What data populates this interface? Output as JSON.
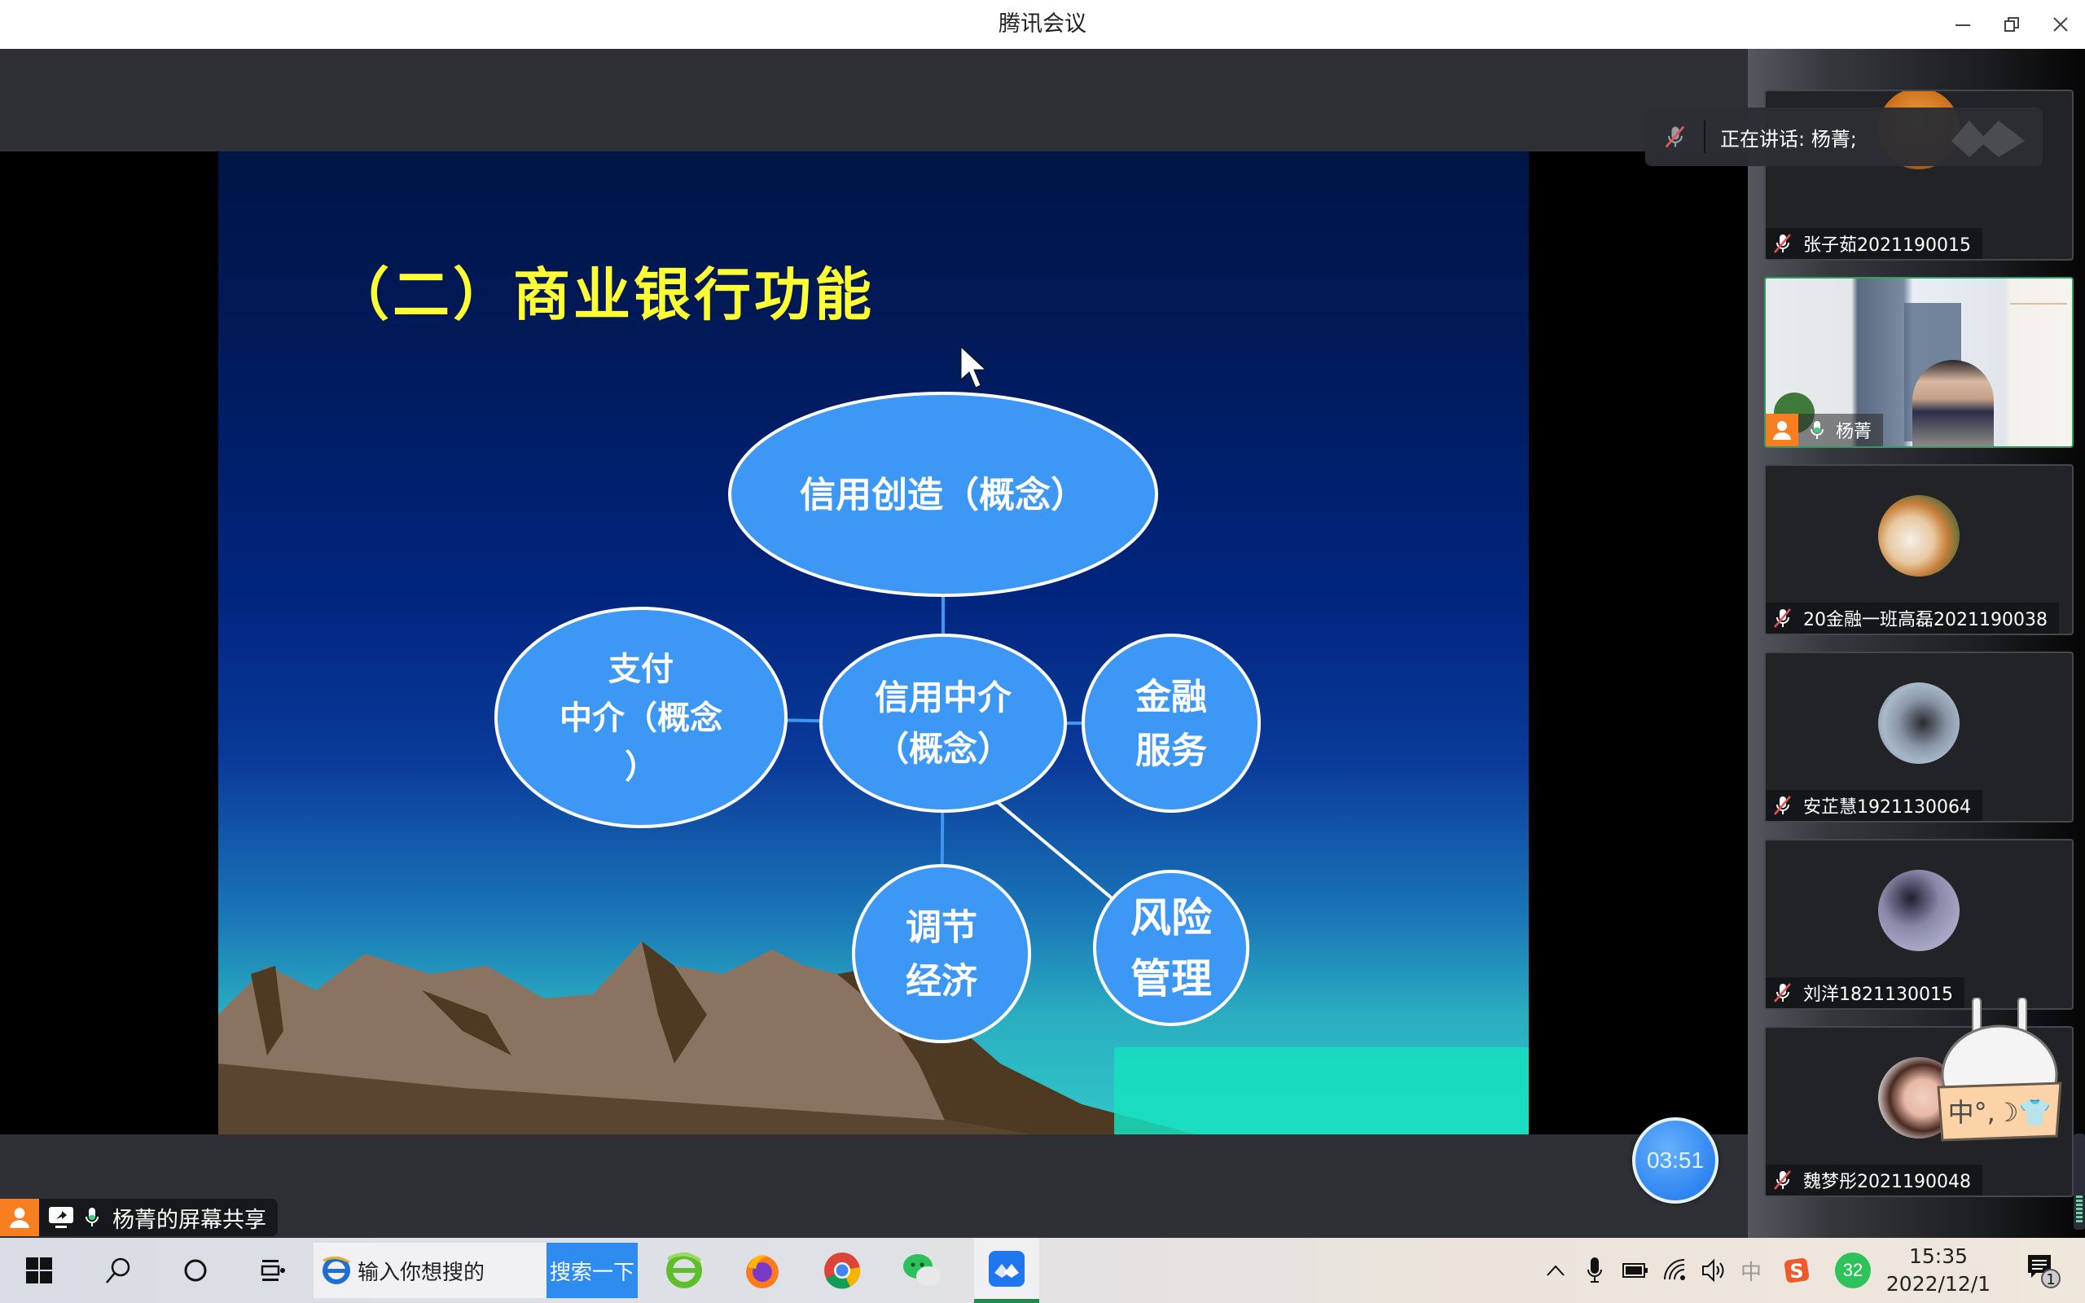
{
  "window": {
    "title": "腾讯会议",
    "controls": [
      "minimize",
      "restore",
      "close"
    ]
  },
  "slide": {
    "title": "（二）商业银行功能",
    "nodes": [
      {
        "id": "credit-creation",
        "lines": [
          "信用创造（概念）"
        ]
      },
      {
        "id": "payment-intermediary",
        "lines": [
          "支付",
          "中介（概念",
          "）"
        ]
      },
      {
        "id": "credit-intermediary",
        "lines": [
          "信用中介",
          "（概念）"
        ]
      },
      {
        "id": "financial-services",
        "lines": [
          "金融",
          "服务"
        ]
      },
      {
        "id": "regulate-economy",
        "lines": [
          "调节",
          "经济"
        ]
      },
      {
        "id": "risk-management",
        "lines": [
          "风险",
          "管理"
        ]
      }
    ],
    "edges": [
      [
        "credit-creation",
        "credit-intermediary"
      ],
      [
        "payment-intermediary",
        "credit-intermediary"
      ],
      [
        "credit-intermediary",
        "financial-services"
      ],
      [
        "credit-intermediary",
        "regulate-economy"
      ],
      [
        "credit-intermediary",
        "risk-management"
      ]
    ],
    "colors": {
      "title": "#ffff33",
      "node_fill": "#3d97f5",
      "node_stroke": "#ffffff"
    }
  },
  "speaking_banner": {
    "text": "正在讲话: 杨菁;"
  },
  "participants": [
    {
      "name": "张子茹2021190015",
      "muted": true,
      "video": false,
      "avatar": "food-photo"
    },
    {
      "name": "杨菁",
      "muted": false,
      "video": true,
      "host": true,
      "speaking": true
    },
    {
      "name": "20金融一班高磊2021190038",
      "muted": true,
      "video": false,
      "avatar": "shiba-dog-photo"
    },
    {
      "name": "安芷慧1921130064",
      "muted": true,
      "video": false,
      "avatar": "person-in-subway-photo"
    },
    {
      "name": "刘洋1821130015",
      "muted": true,
      "video": false,
      "avatar": "man-portrait-photo"
    },
    {
      "name": "魏梦彤2021190048",
      "muted": true,
      "video": false,
      "avatar": "anime-girl-illustration"
    }
  ],
  "ime_sticker": {
    "text": "中°,☽👕"
  },
  "timer": {
    "value": "03:51"
  },
  "share_label": {
    "text": "杨菁的屏幕共享"
  },
  "taskbar": {
    "search_placeholder": "输入你想搜的",
    "search_button": "搜索一下",
    "apps": [
      "360-browser",
      "firefox",
      "chrome",
      "wechat",
      "tencent-meeting"
    ],
    "tray": {
      "ime": "中",
      "badge": "32",
      "time": "15:35",
      "date": "2022/12/1",
      "notifications": "1"
    }
  }
}
